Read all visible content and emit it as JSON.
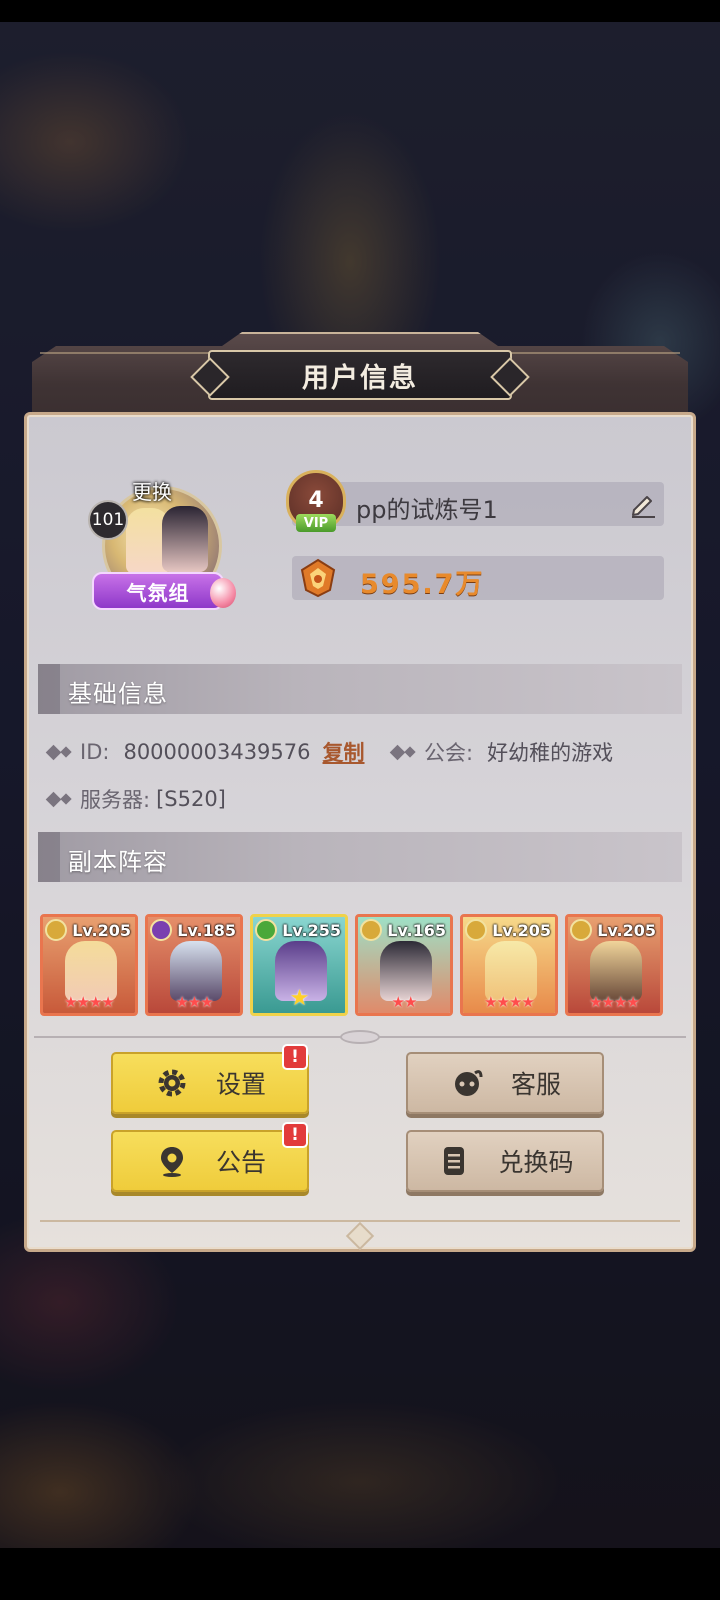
{
  "dialog": {
    "title": "用户信息"
  },
  "profile": {
    "change_label": "更换",
    "level": "101",
    "frame_badge": "气氛组",
    "vip_level": "4",
    "vip_label": "VIP",
    "player_name": "pp的试炼号1",
    "power": "595.7万"
  },
  "basic_info": {
    "section_title": "基础信息",
    "id_label": "ID:",
    "id_value": "80000003439576",
    "copy_label": "复制",
    "guild_label": "公会:",
    "guild_value": "好幼稚的游戏",
    "server_label": "服务器:",
    "server_value": "[S520]"
  },
  "lineup": {
    "section_title": "副本阵容",
    "heroes": [
      {
        "level": "Lv.205",
        "stars": "★★★★",
        "faction": "gold"
      },
      {
        "level": "Lv.185",
        "stars": "★★★",
        "faction": "purple"
      },
      {
        "level": "Lv.255",
        "stars": "★",
        "faction": "green"
      },
      {
        "level": "Lv.165",
        "stars": "★★",
        "faction": "gold"
      },
      {
        "level": "Lv.205",
        "stars": "★★★★",
        "faction": "gold"
      },
      {
        "level": "Lv.205",
        "stars": "★★★★",
        "faction": "gold"
      }
    ]
  },
  "buttons": {
    "settings": "设置",
    "customer_service": "客服",
    "announcement": "公告",
    "redeem_code": "兑换码",
    "alert_mark": "!"
  },
  "icons": {
    "edit": "edit-icon",
    "power": "power-icon",
    "settings": "gear-icon",
    "service": "headset-icon",
    "announcement": "location-pin-icon",
    "redeem": "document-icon"
  },
  "colors": {
    "accent_yellow": "#efcc3b",
    "button_tan": "#cdb8a3",
    "power_orange": "#e88a2c",
    "alert_red": "#e23b3b"
  }
}
